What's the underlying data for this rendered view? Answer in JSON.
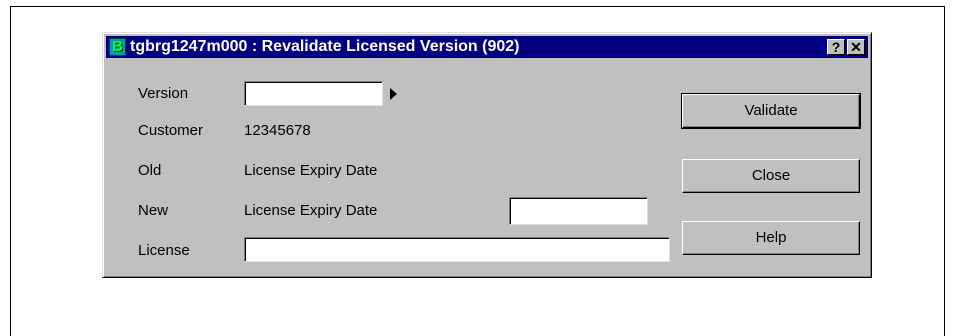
{
  "window": {
    "icon_letter": "B",
    "title": "tgbrg1247m000 : Revalidate Licensed Version (902)",
    "help_button": "?",
    "close_button": "✕"
  },
  "form": {
    "version_label": "Version",
    "version_value": "",
    "customer_label": "Customer",
    "customer_value": "12345678",
    "old_label": "Old",
    "old_field_label": "License Expiry Date",
    "new_label": "New",
    "new_field_label": "License Expiry Date",
    "new_date_value": "",
    "license_label": "License",
    "license_value": ""
  },
  "buttons": {
    "validate": "Validate",
    "close": "Close",
    "help": "Help"
  }
}
